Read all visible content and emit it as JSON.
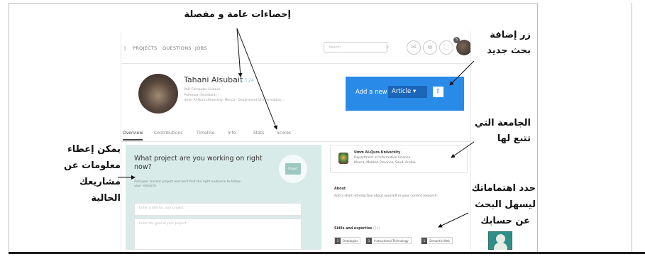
{
  "nav": {
    "items": [
      "PROJECTS",
      "QUESTIONS",
      "JOBS"
    ],
    "search_placeholder": "Search",
    "badge_count": "5"
  },
  "profile": {
    "name": "Tahani Alsubait",
    "rg_score": "♦ 3.24",
    "line1": "PhD Computer Science ·",
    "line2": "Professor (Assistant) ·",
    "line3": "Umm Al-Qura University, Mecca · Department of Information..."
  },
  "add_new": {
    "label": "Add a new",
    "selected": "Article ▾",
    "button_icon": "upload-icon"
  },
  "tabs": [
    "Overview",
    "Contributions",
    "Timeline",
    "Info",
    "Stats",
    "Scores"
  ],
  "project_card": {
    "title": "What project are you working on right now?",
    "description": "Add your current project and we'll find the right audience to follow your research.",
    "folder_label": "Project",
    "title_placeholder": "Enter a title for your project",
    "goal_placeholder": "Enter the goal of your project"
  },
  "institution_card": {
    "name": "Umm Al-Qura University",
    "department": "Department of Information Science",
    "location": "Mecca, Makkah Province, Saudi Arabia"
  },
  "about_card": {
    "heading": "About",
    "text": "Add a short introduction about yourself or your current research."
  },
  "skills_card": {
    "heading": "Skills and expertise",
    "count": "(11)",
    "skills": [
      "Ontologies",
      "Instructional Technology",
      "Semantic Web"
    ],
    "skill_counts": [
      "1",
      "1",
      "1"
    ]
  },
  "annotations": {
    "stats": "إحصاءات عامة و مفصلة",
    "add_research_1": "زر إضافة",
    "add_research_2": "بحث جديد",
    "university_1": "الجامعة التي",
    "university_2": "تتبع لها",
    "projects_1": "يمكن إعطاء",
    "projects_2": "معلومات عن",
    "projects_3": "مشاريعك",
    "projects_4": "الحالية",
    "interests_1": "حدد اهتماماتك",
    "interests_2": "ليسهل البحث",
    "interests_3": "عن حسابك"
  },
  "colors": {
    "accent_blue": "#2a8ae8",
    "project_card_bg": "#d9ebe8"
  }
}
